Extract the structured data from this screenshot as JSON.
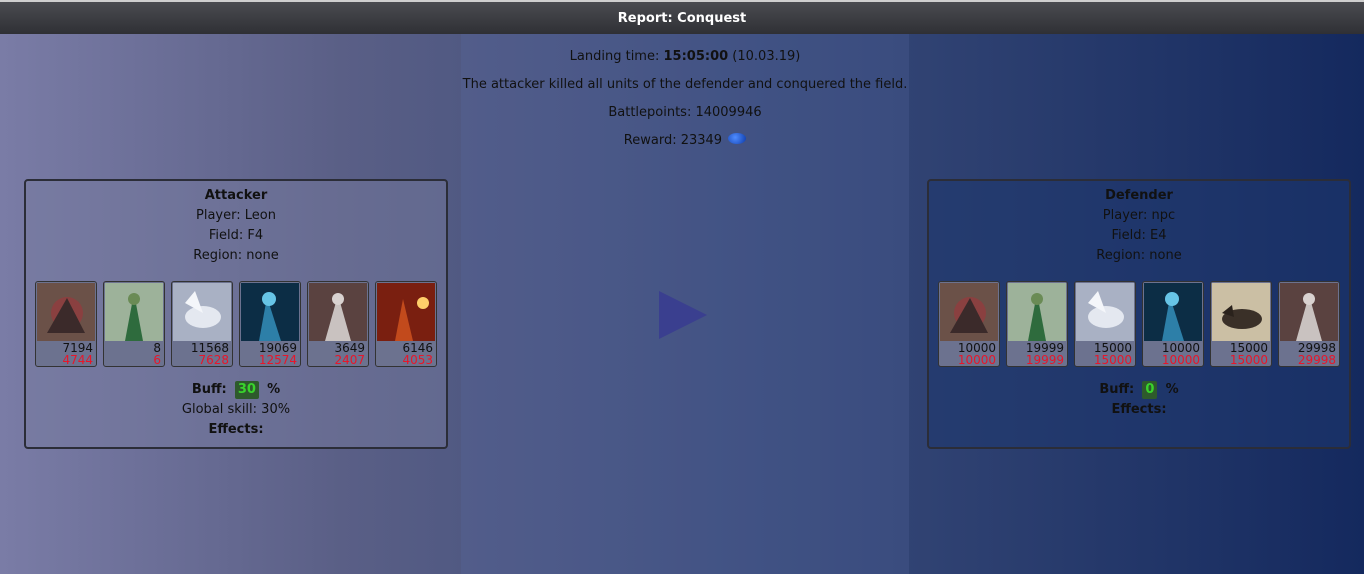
{
  "title": "Report: Conquest",
  "center": {
    "landing_label": "Landing time:",
    "landing_time": "15:05:00",
    "landing_date": "(10.03.19)",
    "message": "The attacker killed all units of the defender and conquered the field.",
    "battlepoints": "Battlepoints: 14009946",
    "reward": "Reward: 23349",
    "reward_icon": "currency-icon"
  },
  "attacker": {
    "heading": "Attacker",
    "player": "Player: Leon",
    "field": "Field: F4",
    "region": "Region: none",
    "units": [
      {
        "count": "7194",
        "loss": "4744",
        "icon": "dragon-icon"
      },
      {
        "count": "8",
        "loss": "6",
        "icon": "green-mage-icon"
      },
      {
        "count": "11568",
        "loss": "7628",
        "icon": "pegasus-icon"
      },
      {
        "count": "19069",
        "loss": "12574",
        "icon": "ice-knight-icon"
      },
      {
        "count": "3649",
        "loss": "2407",
        "icon": "armored-knight-icon"
      },
      {
        "count": "6146",
        "loss": "4053",
        "icon": "fire-mage-icon"
      }
    ],
    "buff_label": "Buff:",
    "buff_value": "30",
    "buff_unit": "%",
    "global_skill": "Global skill: 30%",
    "effects": "Effects:"
  },
  "defender": {
    "heading": "Defender",
    "player": "Player: npc",
    "field": "Field: E4",
    "region": "Region: none",
    "units": [
      {
        "count": "10000",
        "loss": "10000",
        "icon": "dragon-icon"
      },
      {
        "count": "19999",
        "loss": "19999",
        "icon": "green-mage-icon"
      },
      {
        "count": "15000",
        "loss": "15000",
        "icon": "pegasus-icon"
      },
      {
        "count": "10000",
        "loss": "10000",
        "icon": "ice-knight-icon"
      },
      {
        "count": "15000",
        "loss": "15000",
        "icon": "wolf-beast-icon"
      },
      {
        "count": "29998",
        "loss": "29998",
        "icon": "armored-knight-icon"
      }
    ],
    "buff_label": "Buff:",
    "buff_value": "0",
    "buff_unit": "%",
    "effects": "Effects:"
  },
  "colors": {
    "loss": "#e8162a",
    "buff": "#39d42c",
    "arrow": "#3a3f8f"
  }
}
